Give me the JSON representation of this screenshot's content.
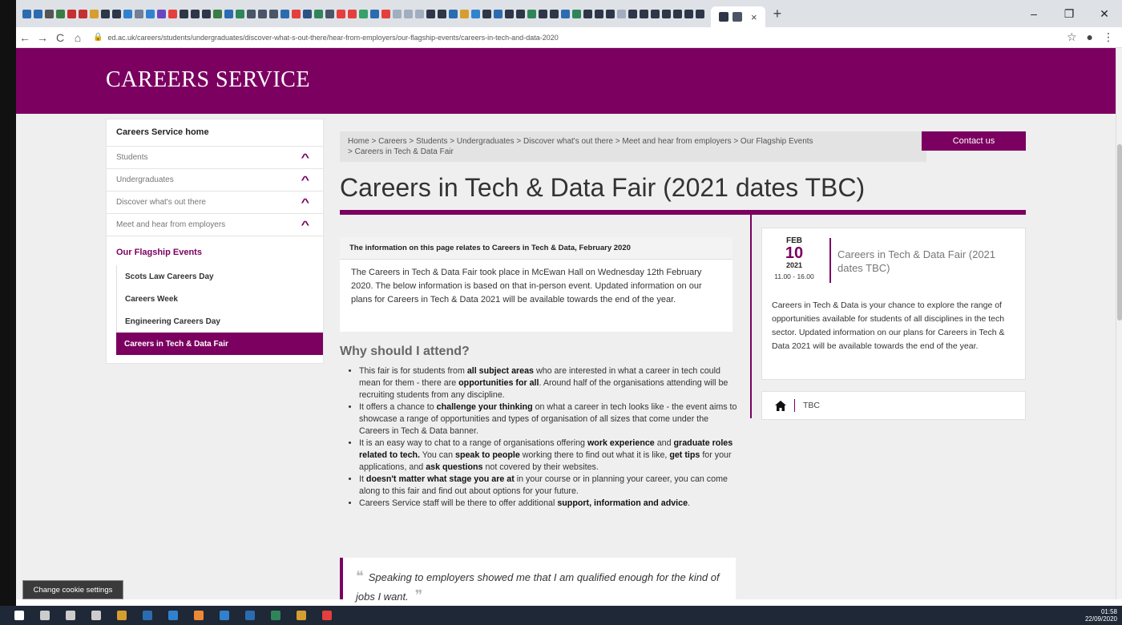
{
  "browser": {
    "url": "ed.ac.uk/careers/students/undergraduates/discover-what-s-out-there/hear-from-employers/our-flagship-events/careers-in-tech-and-data-2020",
    "tab_close": "×",
    "new_tab": "+",
    "win_min": "–",
    "win_max": "❐",
    "win_close": "✕",
    "nav_back": "←",
    "nav_forward": "→",
    "nav_reload": "C",
    "nav_home": "⌂",
    "lock": "🔒",
    "star": "☆",
    "profile": "●",
    "menu": "⋮",
    "tab_icon_colors": [
      "#2b6cb0",
      "#2b6cb0",
      "#555",
      "#3a7d44",
      "#c53030",
      "#c53030",
      "#d69e2e",
      "#2d3748",
      "#2d3748",
      "#3182ce",
      "#718096",
      "#3182ce",
      "#6b46c1",
      "#e53e3e",
      "#2d3748",
      "#2d3748",
      "#2d3748",
      "#3a7d44",
      "#2b6cb0",
      "#2f855a",
      "#4a5568",
      "#4a5568",
      "#4a5568",
      "#2b6cb0",
      "#e53e3e",
      "#2c5282",
      "#2f855a",
      "#4a5568",
      "#e53e3e",
      "#e53e3e",
      "#38a169",
      "#2b6cb0",
      "#e53e3e",
      "#a0aec0",
      "#a0aec0",
      "#a0aec0",
      "#2d3748",
      "#2d3748",
      "#2b6cb0",
      "#d69e2e",
      "#3182ce",
      "#2d3748",
      "#2b6cb0",
      "#2d3748",
      "#2d3748",
      "#2f855a",
      "#2d3748",
      "#2d3748",
      "#2b6cb0",
      "#2f855a",
      "#2d3748",
      "#2d3748",
      "#2d3748",
      "#a0aec0",
      "#2d3748",
      "#2d3748",
      "#2d3748",
      "#2d3748",
      "#2d3748",
      "#2d3748",
      "#2d3748"
    ]
  },
  "site": {
    "title": "CAREERS SERVICE",
    "brand_color": "#7b0060"
  },
  "sidebar": {
    "home": "Careers Service home",
    "items": [
      {
        "label": "Students"
      },
      {
        "label": "Undergraduates"
      },
      {
        "label": "Discover what's out there"
      },
      {
        "label": "Meet and hear from employers"
      }
    ],
    "section": "Our Flagship Events",
    "sub_items": [
      {
        "label": "Scots Law Careers Day"
      },
      {
        "label": "Careers Week"
      },
      {
        "label": "Engineering Careers Day"
      },
      {
        "label": "Careers in Tech & Data Fair"
      }
    ]
  },
  "breadcrumb": {
    "line1": "Home  >  Careers  >  Students  >  Undergraduates  >  Discover what's out there  >  Meet and hear from employers  >  Our Flagship Events",
    "line2_prefix": ">  ",
    "current": "Careers in Tech & Data Fair"
  },
  "contact_button": "Contact us",
  "page_title": "Careers in Tech & Data Fair (2021 dates TBC)",
  "info_box": {
    "heading": "The information on this page relates to Careers in Tech & Data, February 2020",
    "body": "The Careers in Tech & Data Fair took place in McEwan Hall on Wednesday  12th February 2020. The below information is based on that in-person event. Updated information on our plans for Careers in Tech & Data 2021 will be available towards the end of the year."
  },
  "why": {
    "heading": "Why should I attend?",
    "b1": {
      "t1": "This fair is for students from ",
      "b1": "all subject areas",
      "t2": " who are interested in what a career in tech could mean for them - there are ",
      "b2": "opportunities for all",
      "t3": ".  Around half of the organisations attending will be recruiting students from any discipline."
    },
    "b2": {
      "t1": "It offers a chance to ",
      "b1": "challenge your thinking",
      "t2": " on what a career in tech looks like - the event aims to showcase a range of opportunities and types of organisation of all sizes that come under the Careers in Tech & Data banner."
    },
    "b3": {
      "t1": "It is an easy way to chat to a range of organisations offering ",
      "b1": "work experience",
      "t2": " and ",
      "b2": "graduate roles related to tech.",
      "t3": "  You can ",
      "b3": "speak to people",
      "t4": " working there to find out what it is like, ",
      "b4": "get tips",
      "t5": " for your applications, and ",
      "b5": "ask questions",
      "t6": " not covered by their websites."
    },
    "b4": {
      "t1": "It ",
      "b1": "doesn't matter what stage you are at",
      "t2": " in your course or in planning your career, you can come along to this fair and find out about options for your future."
    },
    "b5": {
      "t1": "Careers Service staff will be there to offer additional ",
      "b1": "support, information and advice",
      "t2": "."
    }
  },
  "quote": {
    "open": "❝",
    "text": "Speaking to employers showed me that I am qualified enough for the kind of jobs I want.",
    "close": "❞"
  },
  "event": {
    "month": "FEB",
    "day": "10",
    "year": "2021",
    "time": "11.00 - 16.00",
    "title": "Careers in Tech & Data Fair (2021 dates TBC)",
    "description": "Careers in Tech & Data is your chance to explore the range of opportunities available for students of all disciplines in the tech sector. Updated information on our plans for Careers in Tech & Data 2021 will be available towards the end of the year.",
    "venue": "TBC"
  },
  "cookie_button": "Change cookie settings",
  "taskbar": {
    "icon_colors": [
      "#ffffff",
      "#cccccc",
      "#cccccc",
      "#cccccc",
      "#d69e2e",
      "#2b6cb0",
      "#3182ce",
      "#ed8936",
      "#3182ce",
      "#2b6cb0",
      "#2f855a",
      "#d69e2e",
      "#e53e3e"
    ],
    "time": "01:58",
    "date": "22/09/2020"
  }
}
